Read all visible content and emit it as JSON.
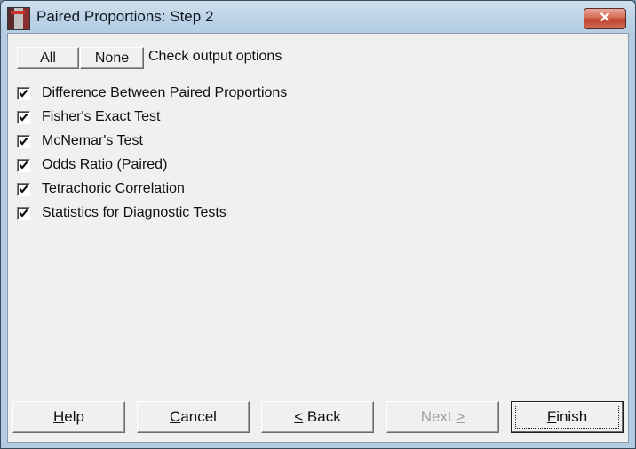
{
  "window": {
    "title": "Paired Proportions: Step 2",
    "close_symbol": "✕"
  },
  "selection": {
    "all_label": "All",
    "none_label": "None",
    "hint": "Check output options"
  },
  "options": [
    {
      "label": "Difference Between Paired Proportions",
      "checked": true
    },
    {
      "label": "Fisher's Exact Test",
      "checked": true
    },
    {
      "label": "McNemar's Test",
      "checked": true
    },
    {
      "label": "Odds Ratio (Paired)",
      "checked": true
    },
    {
      "label": "Tetrachoric Correlation",
      "checked": true
    },
    {
      "label": "Statistics for Diagnostic Tests",
      "checked": true
    }
  ],
  "footer": {
    "help": {
      "mnemonic": "H",
      "rest": "elp"
    },
    "cancel": {
      "mnemonic": "C",
      "rest": "ancel"
    },
    "back": {
      "mnemonic": "<",
      "rest": " Back"
    },
    "next": {
      "label": "Next ",
      "mnemonic": ">",
      "enabled": false
    },
    "finish": {
      "mnemonic": "F",
      "rest": "inish"
    }
  }
}
